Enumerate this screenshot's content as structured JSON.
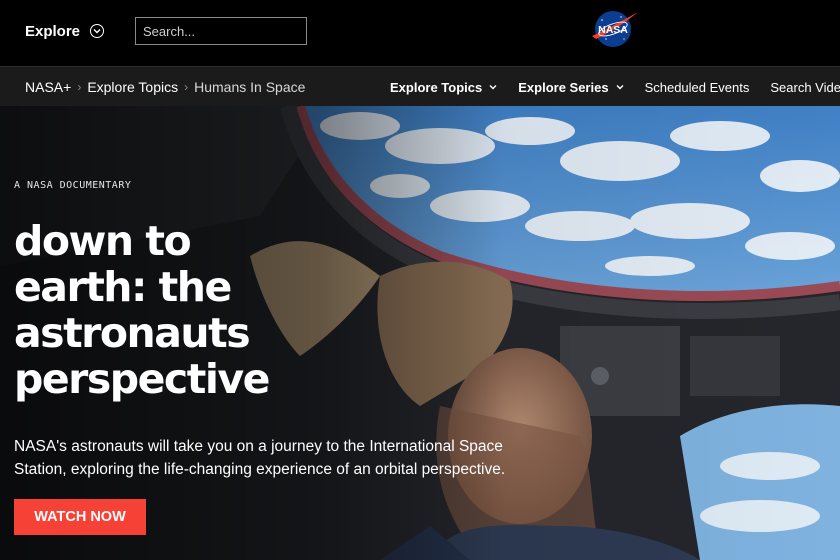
{
  "header": {
    "explore_label": "Explore",
    "search_placeholder": "Search...",
    "logo_text": "NASA"
  },
  "breadcrumb": [
    "NASA+",
    "Explore Topics",
    "Humans In Space"
  ],
  "nav": {
    "explore_topics": "Explore Topics",
    "explore_series": "Explore Series",
    "scheduled_events": "Scheduled Events",
    "search_videos": "Search Videos"
  },
  "hero": {
    "eyebrow": "A NASA DOCUMENTARY",
    "title_lines": [
      "down to",
      "earth: the",
      "astronauts",
      "perspective"
    ],
    "description": "NASA's astronauts will take you on a journey to the International Space Station, exploring the life-changing experience of an orbital perspective.",
    "cta_label": "WATCH NOW"
  },
  "colors": {
    "cta": "#f64137",
    "nav_background": "#1b1b1b",
    "top_background": "#000000"
  }
}
